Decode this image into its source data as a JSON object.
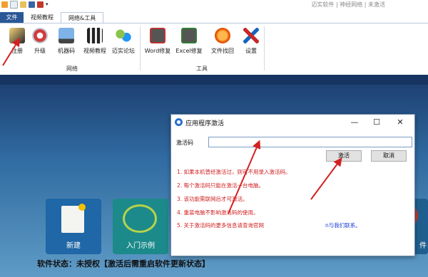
{
  "brand": {
    "text": "迈实软件 | 神经网络 | 未激活"
  },
  "tabs": [
    {
      "label": "文件"
    },
    {
      "label": "视频教程"
    },
    {
      "label": "网络&工具"
    }
  ],
  "ribbon": {
    "network_buttons": [
      {
        "label": "注册",
        "icon": "register-icon"
      },
      {
        "label": "升级",
        "icon": "upgrade-icon"
      },
      {
        "label": "机器码",
        "icon": "computer-icon"
      },
      {
        "label": "视频教程",
        "icon": "video-icon"
      },
      {
        "label": "迈实论坛",
        "icon": "forum-icon"
      }
    ],
    "network_group": "网络",
    "tool_buttons": [
      {
        "label": "Word修复",
        "icon": "word-doc-icon"
      },
      {
        "label": "Excel修复",
        "icon": "excel-xls-icon"
      },
      {
        "label": "文件找回",
        "icon": "file-recovery-icon"
      },
      {
        "label": "设置",
        "icon": "settings-tools-icon"
      }
    ],
    "tools_group": "工具"
  },
  "desktop": {
    "tiles": [
      {
        "label": "新建"
      },
      {
        "label": "入门示例"
      },
      {
        "label": ""
      },
      {
        "label": ""
      },
      {
        "label": ""
      },
      {
        "label": "件"
      }
    ],
    "status": "软件状态：未授权【激活后需重启软件更新状态】"
  },
  "dialog": {
    "title": "应用程序激活",
    "min": "—",
    "max": "☐",
    "close": "✕",
    "code_label": "激活码",
    "code_value": "",
    "activate_label": "激活",
    "cancel_label": "取消",
    "notes": [
      "1. 如果本机曾经激活过，则可不用录入激活码。",
      "2. 每个激活码只能在激活一台电脑。",
      "3. 该功能需联网后才可激活。",
      "4. 重装电脑不影响激活码的使用。",
      "5. 关于激活码的更多信息请查询官网"
    ],
    "contact_link": "n与我们联系。"
  }
}
